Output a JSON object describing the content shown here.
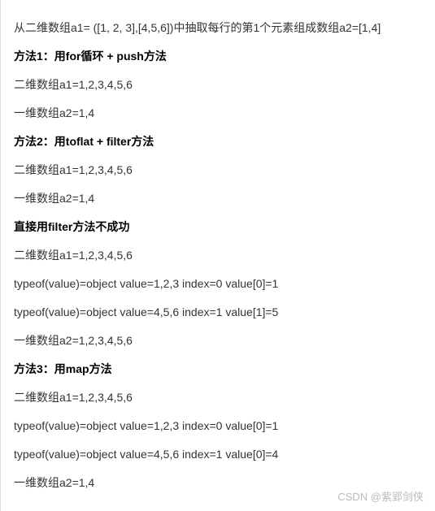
{
  "lines": [
    {
      "text": "从二维数组a1= ([1, 2, 3],[4,5,6])中抽取每行的第1个元素组成数组a2=[1,4]",
      "bold": false
    },
    {
      "text": "方法1：用for循环 + push方法",
      "bold": true
    },
    {
      "text": "二维数组a1=1,2,3,4,5,6",
      "bold": false
    },
    {
      "text": "一维数组a2=1,4",
      "bold": false
    },
    {
      "text": "方法2：用toflat + filter方法",
      "bold": true
    },
    {
      "text": "二维数组a1=1,2,3,4,5,6",
      "bold": false
    },
    {
      "text": "一维数组a2=1,4",
      "bold": false
    },
    {
      "text": "直接用filter方法不成功",
      "bold": true
    },
    {
      "text": "二维数组a1=1,2,3,4,5,6",
      "bold": false
    },
    {
      "text": "typeof(value)=object value=1,2,3 index=0 value[0]=1",
      "bold": false
    },
    {
      "text": "typeof(value)=object value=4,5,6 index=1 value[1]=5",
      "bold": false
    },
    {
      "text": "一维数组a2=1,2,3,4,5,6",
      "bold": false
    },
    {
      "text": "方法3：用map方法",
      "bold": true
    },
    {
      "text": "二维数组a1=1,2,3,4,5,6",
      "bold": false
    },
    {
      "text": "typeof(value)=object value=1,2,3 index=0 value[0]=1",
      "bold": false
    },
    {
      "text": "typeof(value)=object value=4,5,6 index=1 value[0]=4",
      "bold": false
    },
    {
      "text": "一维数组a2=1,4",
      "bold": false
    }
  ],
  "watermark": "CSDN @紫郢剑侠"
}
